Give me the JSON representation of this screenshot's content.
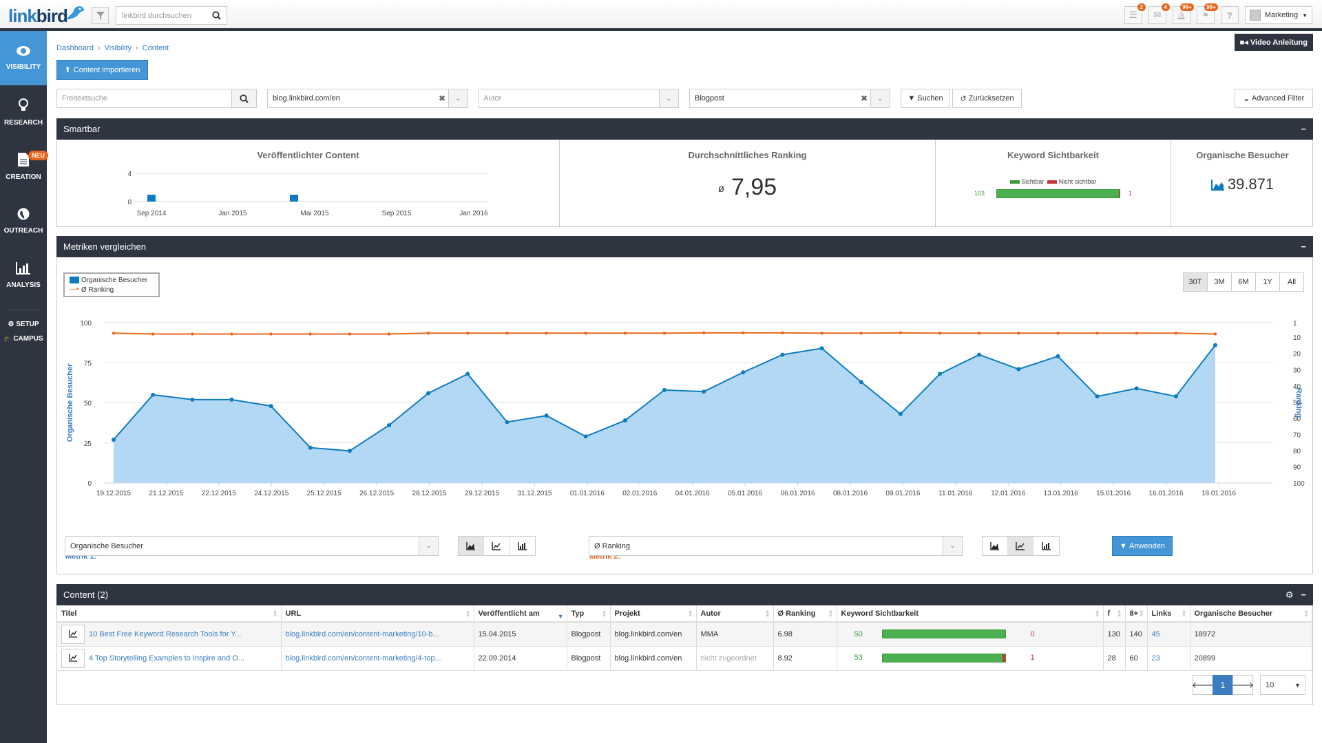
{
  "header": {
    "logo_text_a": "link",
    "logo_text_b": "bird",
    "search_placeholder": "linkbird durchsuchen",
    "icons": [
      {
        "name": "tasks-icon",
        "glyph": "☰",
        "badge": "2"
      },
      {
        "name": "mail-icon",
        "glyph": "✉",
        "badge": "4"
      },
      {
        "name": "bell-icon",
        "glyph": "🔔",
        "badge": "99+"
      },
      {
        "name": "links-icon",
        "glyph": "⚭",
        "badge": "99+"
      },
      {
        "name": "help-icon",
        "glyph": "?",
        "badge": ""
      }
    ],
    "user_label": "Marketing"
  },
  "sidebar": {
    "items": [
      {
        "label": "VISIBILITY",
        "icon": "eye-icon",
        "glyph": "👁",
        "active": true
      },
      {
        "label": "RESEARCH",
        "icon": "lightbulb-icon",
        "glyph": "💡"
      },
      {
        "label": "CREATION",
        "icon": "document-icon",
        "glyph": "📄",
        "badge": "NEU"
      },
      {
        "label": "OUTREACH",
        "icon": "globe-icon",
        "glyph": "🌍"
      },
      {
        "label": "ANALYSIS",
        "icon": "bar-chart-icon",
        "glyph": "📊"
      }
    ],
    "small_items": [
      {
        "label": "SETUP",
        "glyph": "⚙"
      },
      {
        "label": "CAMPUS",
        "glyph": "🎓"
      }
    ]
  },
  "breadcrumb": [
    "Dashboard",
    "Visibility",
    "Content"
  ],
  "video_button": "Video Anleitung",
  "import_button": "Content importieren",
  "filters": {
    "freetext_placeholder": "Freitextsuche",
    "project_value": "blog.linkbird.com/en",
    "author_placeholder": "Autor",
    "type_value": "Blogpost",
    "search_button": "Suchen",
    "reset_button": "Zurücksetzen",
    "advanced_button": "Advanced Filter"
  },
  "smartbar": {
    "title": "Smartbar",
    "published_content": {
      "title": "Veröffentlichter Content",
      "y_ticks": [
        "4",
        "0"
      ],
      "x_ticks": [
        "Sep 2014",
        "Jan 2015",
        "Mai 2015",
        "Sep 2015",
        "Jan 2016"
      ]
    },
    "avg_ranking": {
      "title": "Durchschnittliches Ranking",
      "symbol": "ø",
      "value": "7,95"
    },
    "keyword_visibility": {
      "title": "Keyword Sichtbarkeit",
      "legend_visible": "Sichtbar",
      "legend_not_visible": "Nicht sichtbar",
      "visible": "103",
      "not_visible": "1",
      "visible_fraction": 0.99
    },
    "organic_visitors": {
      "title": "Organische Besucher",
      "value": "39.871"
    }
  },
  "metrics": {
    "title": "Metriken vergleichen",
    "range_buttons": [
      "30T",
      "3M",
      "6M",
      "1Y",
      "All"
    ],
    "active_range": "30T",
    "metric1_label": "Metrik 1:",
    "metric1_value": "Organische Besucher",
    "metric2_label": "Metrik 2:",
    "metric2_value": "Ø Ranking",
    "apply_button": "Anwenden"
  },
  "chart_data": {
    "type": "area",
    "title": "",
    "legend": [
      "Organische Besucher",
      "Ø Ranking"
    ],
    "legend_position": "top-left",
    "categories": [
      "19.12.2015",
      "21.12.2015",
      "22.12.2015",
      "24.12.2015",
      "25.12.2015",
      "26.12.2015",
      "28.12.2015",
      "29.12.2015",
      "31.12.2015",
      "01.01.2016",
      "02.01.2016",
      "04.01.2016",
      "05.01.2016",
      "06.01.2016",
      "08.01.2016",
      "09.01.2016",
      "11.01.2016",
      "12.01.2016",
      "13.01.2016",
      "15.01.2016",
      "16.01.2016",
      "18.01.2016"
    ],
    "ylabel": "Organische Besucher",
    "y2label": "Ranking",
    "ylim": [
      0,
      100
    ],
    "y_ticks": [
      0,
      25,
      50,
      75,
      100
    ],
    "y2lim": [
      1,
      100
    ],
    "y2_ticks": [
      1,
      10,
      20,
      30,
      40,
      50,
      60,
      70,
      80,
      90,
      100
    ],
    "grid": true,
    "series": [
      {
        "name": "Organische Besucher",
        "axis": "left",
        "type": "area",
        "color": "#0d7bbf",
        "values": [
          27,
          55,
          52,
          52,
          48,
          22,
          20,
          36,
          56,
          68,
          38,
          42,
          29,
          39,
          58,
          57,
          69,
          80,
          84,
          63,
          43,
          68,
          80,
          71,
          79,
          54,
          59,
          54,
          86
        ]
      },
      {
        "name": "Ø Ranking",
        "axis": "right",
        "type": "line",
        "color": "#e8661c",
        "values": [
          7.5,
          8,
          8,
          8,
          8,
          8,
          8,
          8,
          7.5,
          7.5,
          7.5,
          7.5,
          7.5,
          7.5,
          7.5,
          7.3,
          7.3,
          7.3,
          7.5,
          7.5,
          7.3,
          7.5,
          7.5,
          7.5,
          7.5,
          7.5,
          7.5,
          7.5,
          8
        ]
      }
    ]
  },
  "content_table": {
    "title": "Content (2)",
    "columns": [
      "Titel",
      "URL",
      "Veröffentlicht am",
      "Typ",
      "Projekt",
      "Autor",
      "Ø Ranking",
      "Keyword Sichtbarkeit",
      "f",
      "8+",
      "Links",
      "Organische Besucher"
    ],
    "rows": [
      {
        "title": "10 Best Free Keyword Research Tools for Y...",
        "url": "blog.linkbird.com/en/content-marketing/10-b...",
        "published": "15.04.2015",
        "type": "Blogpost",
        "project": "blog.linkbird.com/en",
        "author": "MMA",
        "ranking": "6.98",
        "kw_visible": "50",
        "kw_not_visible": "0",
        "kw_visible_fraction": 1.0,
        "facebook": "130",
        "gplus": "140",
        "links": "45",
        "visitors": "18972"
      },
      {
        "title": "4 Top Storytelling Examples to Inspire and O...",
        "url": "blog.linkbird.com/en/content-marketing/4-top...",
        "published": "22.09.2014",
        "type": "Blogpost",
        "project": "blog.linkbird.com/en",
        "author": "nicht zugeordnet",
        "ranking": "8.92",
        "kw_visible": "53",
        "kw_not_visible": "1",
        "kw_visible_fraction": 0.98,
        "facebook": "28",
        "gplus": "60",
        "links": "23",
        "visitors": "20899"
      }
    ],
    "pagination": {
      "current": "1",
      "page_size": "10"
    }
  }
}
